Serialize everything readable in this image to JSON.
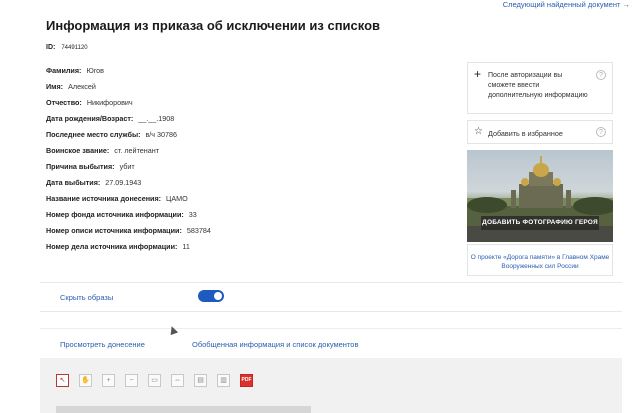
{
  "header": {
    "next_link": "Следующий найденный документ →",
    "title": "Информация из приказа об исключении из списков",
    "id_label": "ID:",
    "id_value": "74491120"
  },
  "fields": [
    {
      "label": "Фамилия:",
      "value": "Югов"
    },
    {
      "label": "Имя:",
      "value": "Алексей"
    },
    {
      "label": "Отчество:",
      "value": "Никифорович"
    },
    {
      "label": "Дата рождения/Возраст:",
      "value": "__.__.1908"
    },
    {
      "label": "Последнее место службы:",
      "value": "в/ч 30786"
    },
    {
      "label": "Воинское звание:",
      "value": "ст. лейтенант"
    },
    {
      "label": "Причина выбытия:",
      "value": "убит"
    },
    {
      "label": "Дата выбытия:",
      "value": "27.09.1943"
    },
    {
      "label": "Название источника донесения:",
      "value": "ЦАМО"
    },
    {
      "label": "Номер фонда источника информации:",
      "value": "33"
    },
    {
      "label": "Номер описи источника информации:",
      "value": "583784"
    },
    {
      "label": "Номер дела источника информации:",
      "value": "11"
    }
  ],
  "sidebar": {
    "auth_text": "После авторизации вы сможете ввести дополнительную информацию",
    "favorite_label": "Добавить в избранное",
    "add_photo_label": "ДОБАВИТЬ ФОТОГРАФИЮ ГЕРОЯ",
    "about_link": "О проекте «Дорога памяти» в Главном Храме Вооруженных сил России",
    "help_glyph": "?"
  },
  "toggle": {
    "label": "Скрыть образы",
    "on": true
  },
  "tabs": [
    {
      "label": "Просмотреть донесение"
    },
    {
      "label": "Обобщенная информация и список документов"
    }
  ],
  "toolbar": {
    "tools": [
      "select-icon",
      "hand-icon",
      "zoom-in-icon",
      "zoom-out-icon",
      "fit-page-icon",
      "fit-width-icon",
      "split-horizontal-icon",
      "split-vertical-icon",
      "pdf-icon"
    ],
    "pdf_label": "PDF"
  },
  "colors": {
    "link": "#2a5db0",
    "toggle_on": "#1f5bbf",
    "pdf": "#d9322f"
  }
}
